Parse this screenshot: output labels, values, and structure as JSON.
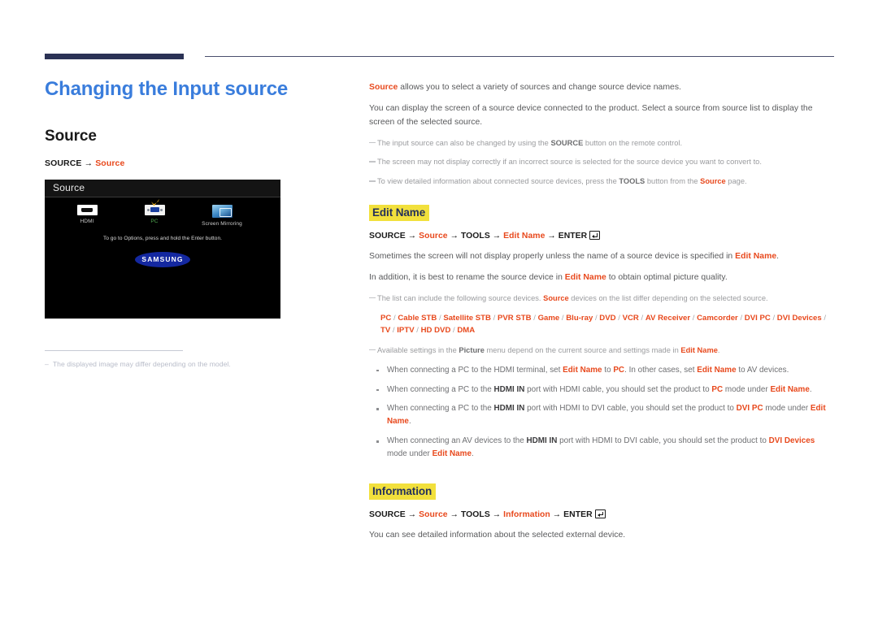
{
  "header": {
    "rule_thick_color": "#2b3255",
    "rule_thin_color": "#4a4f6e"
  },
  "left": {
    "page_title": "Changing the Input source",
    "section_title": "Source",
    "path": {
      "start": "SOURCE",
      "arrow": "→",
      "target": "Source"
    },
    "tv_mock": {
      "window_title": "Source",
      "items": [
        {
          "label": "HDMI",
          "icon": "hdmi-port-icon",
          "selected": false
        },
        {
          "label": "PC",
          "icon": "vga-port-icon",
          "selected": true
        },
        {
          "label": "Screen Mirroring",
          "icon": "screen-mirroring-icon",
          "selected": false
        }
      ],
      "hint": "To go to Options, press and hold the Enter button.",
      "logo": "SAMSUNG",
      "check_color": "#f0b323",
      "selected_label_color": "#4ea64e"
    },
    "footnote": {
      "dash": "–",
      "text": "The displayed image may differ depending on the model."
    }
  },
  "right": {
    "intro": {
      "lead_term": "Source",
      "lead_rest": " allows you to select a variety of sources and change source device names.",
      "paragraph": "You can display the screen of a source device connected to the product. Select a source from source list to display the screen of the selected source."
    },
    "notes_top": [
      {
        "parts": [
          {
            "t": "The input source can also be changed by using the ",
            "s": "plain"
          },
          {
            "t": "SOURCE",
            "s": "bold"
          },
          {
            "t": " button on the remote control.",
            "s": "plain"
          }
        ]
      },
      {
        "parts": [
          {
            "t": "The screen may not display correctly if an incorrect source is selected for the source device you want to convert to.",
            "s": "plain"
          }
        ]
      },
      {
        "parts": [
          {
            "t": "To view detailed information about connected source devices, press the ",
            "s": "plain"
          },
          {
            "t": "TOOLS",
            "s": "bold"
          },
          {
            "t": " button from the ",
            "s": "plain"
          },
          {
            "t": "Source",
            "s": "red"
          },
          {
            "t": " page.",
            "s": "plain"
          }
        ]
      }
    ],
    "edit_name": {
      "heading": "Edit Name",
      "path": {
        "p1": "SOURCE",
        "p2": "Source",
        "p3": "TOOLS",
        "p4": "Edit Name",
        "p5": "ENTER",
        "arrow": "→",
        "enter_icon": "enter-key-icon"
      },
      "paragraphs": [
        {
          "parts": [
            {
              "t": "Sometimes the screen will not display properly unless the name of a source device is specified in ",
              "s": "plain"
            },
            {
              "t": "Edit Name",
              "s": "red"
            },
            {
              "t": ".",
              "s": "plain"
            }
          ]
        },
        {
          "parts": [
            {
              "t": "In addition, it is best to rename the source device in ",
              "s": "plain"
            },
            {
              "t": "Edit Name",
              "s": "red"
            },
            {
              "t": " to obtain optimal picture quality.",
              "s": "plain"
            }
          ]
        }
      ],
      "device_note": {
        "parts": [
          {
            "t": "The list can include the following source devices. ",
            "s": "plain"
          },
          {
            "t": "Source",
            "s": "red"
          },
          {
            "t": " devices on the list differ depending on the selected source.",
            "s": "plain"
          }
        ]
      },
      "device_list": [
        "PC",
        "Cable STB",
        "Satellite STB",
        "PVR STB",
        "Game",
        "Blu-ray",
        "DVD",
        "VCR",
        "AV Receiver",
        "Camcorder",
        "DVI PC",
        "DVI Devices",
        "TV",
        "IPTV",
        "HD DVD",
        "DMA"
      ],
      "device_list_separator": "/",
      "picture_note": {
        "parts": [
          {
            "t": "Available settings in the ",
            "s": "plain"
          },
          {
            "t": "Picture",
            "s": "bold"
          },
          {
            "t": " menu depend on the current source and settings made in ",
            "s": "plain"
          },
          {
            "t": "Edit Name",
            "s": "red"
          },
          {
            "t": ".",
            "s": "plain"
          }
        ]
      },
      "bullets": [
        {
          "parts": [
            {
              "t": "When connecting a PC to the HDMI terminal, set ",
              "s": "plain"
            },
            {
              "t": "Edit Name",
              "s": "red"
            },
            {
              "t": " to ",
              "s": "plain"
            },
            {
              "t": "PC",
              "s": "red"
            },
            {
              "t": ". In other cases, set ",
              "s": "plain"
            },
            {
              "t": "Edit Name",
              "s": "red"
            },
            {
              "t": " to AV devices.",
              "s": "plain"
            }
          ]
        },
        {
          "parts": [
            {
              "t": "When connecting a PC to the ",
              "s": "plain"
            },
            {
              "t": "HDMI IN",
              "s": "bold"
            },
            {
              "t": " port with HDMI cable, you should set the product to ",
              "s": "plain"
            },
            {
              "t": "PC",
              "s": "red"
            },
            {
              "t": " mode under ",
              "s": "plain"
            },
            {
              "t": "Edit Name",
              "s": "red"
            },
            {
              "t": ".",
              "s": "plain"
            }
          ]
        },
        {
          "parts": [
            {
              "t": "When connecting a PC to the ",
              "s": "plain"
            },
            {
              "t": "HDMI IN",
              "s": "bold"
            },
            {
              "t": " port with HDMI to DVI cable, you should set the product to ",
              "s": "plain"
            },
            {
              "t": "DVI PC",
              "s": "red"
            },
            {
              "t": " mode under ",
              "s": "plain"
            },
            {
              "t": "Edit Name",
              "s": "red"
            },
            {
              "t": ".",
              "s": "plain"
            }
          ]
        },
        {
          "parts": [
            {
              "t": "When connecting an AV devices to the ",
              "s": "plain"
            },
            {
              "t": "HDMI IN",
              "s": "bold"
            },
            {
              "t": " port with HDMI to DVI cable, you should set the product to ",
              "s": "plain"
            },
            {
              "t": "DVI Devices",
              "s": "red"
            },
            {
              "t": " mode under ",
              "s": "plain"
            },
            {
              "t": "Edit Name",
              "s": "red"
            },
            {
              "t": ".",
              "s": "plain"
            }
          ]
        }
      ]
    },
    "information": {
      "heading": "Information",
      "path": {
        "p1": "SOURCE",
        "p2": "Source",
        "p3": "TOOLS",
        "p4": "Information",
        "p5": "ENTER",
        "arrow": "→",
        "enter_icon": "enter-key-icon"
      },
      "paragraph": "You can see detailed information about the selected external device."
    }
  },
  "colors": {
    "title_blue": "#3a7ddc",
    "accent_red": "#e8491d",
    "highlight_yellow": "#f2e03c",
    "highlight_text": "#24305b",
    "body_gray": "#58595b",
    "note_gray": "#9a9b9e"
  }
}
